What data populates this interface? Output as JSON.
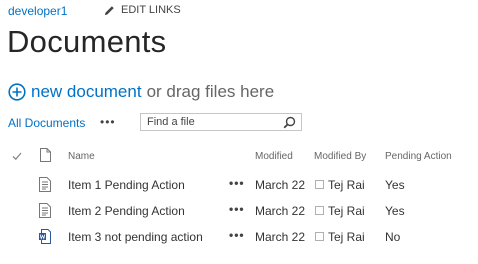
{
  "breadcrumb": {
    "site": "developer1",
    "edit_links": "EDIT LINKS"
  },
  "page": {
    "title": "Documents"
  },
  "new_document": {
    "link": "new document",
    "rest": "or drag files here"
  },
  "views": {
    "current": "All Documents",
    "more": "•••"
  },
  "search": {
    "placeholder": "Find a file"
  },
  "columns": {
    "name": "Name",
    "modified": "Modified",
    "modified_by": "Modified By",
    "pending_action": "Pending Action"
  },
  "rows": [
    {
      "name": "Item 1 Pending Action",
      "dots": "•••",
      "modified": "March 22",
      "modified_by": "Tej Rai",
      "pending_action": "Yes",
      "icon": "text-doc-icon"
    },
    {
      "name": "Item 2 Pending Action",
      "dots": "•••",
      "modified": "March 22",
      "modified_by": "Tej Rai",
      "pending_action": "Yes",
      "icon": "text-doc-icon"
    },
    {
      "name": "Item 3 not pending action",
      "dots": "•••",
      "modified": "March 22",
      "modified_by": "Tej Rai",
      "pending_action": "No",
      "icon": "word-doc-icon"
    }
  ],
  "colors": {
    "link": "#0072c6",
    "title": "#262626",
    "text": "#444444"
  }
}
